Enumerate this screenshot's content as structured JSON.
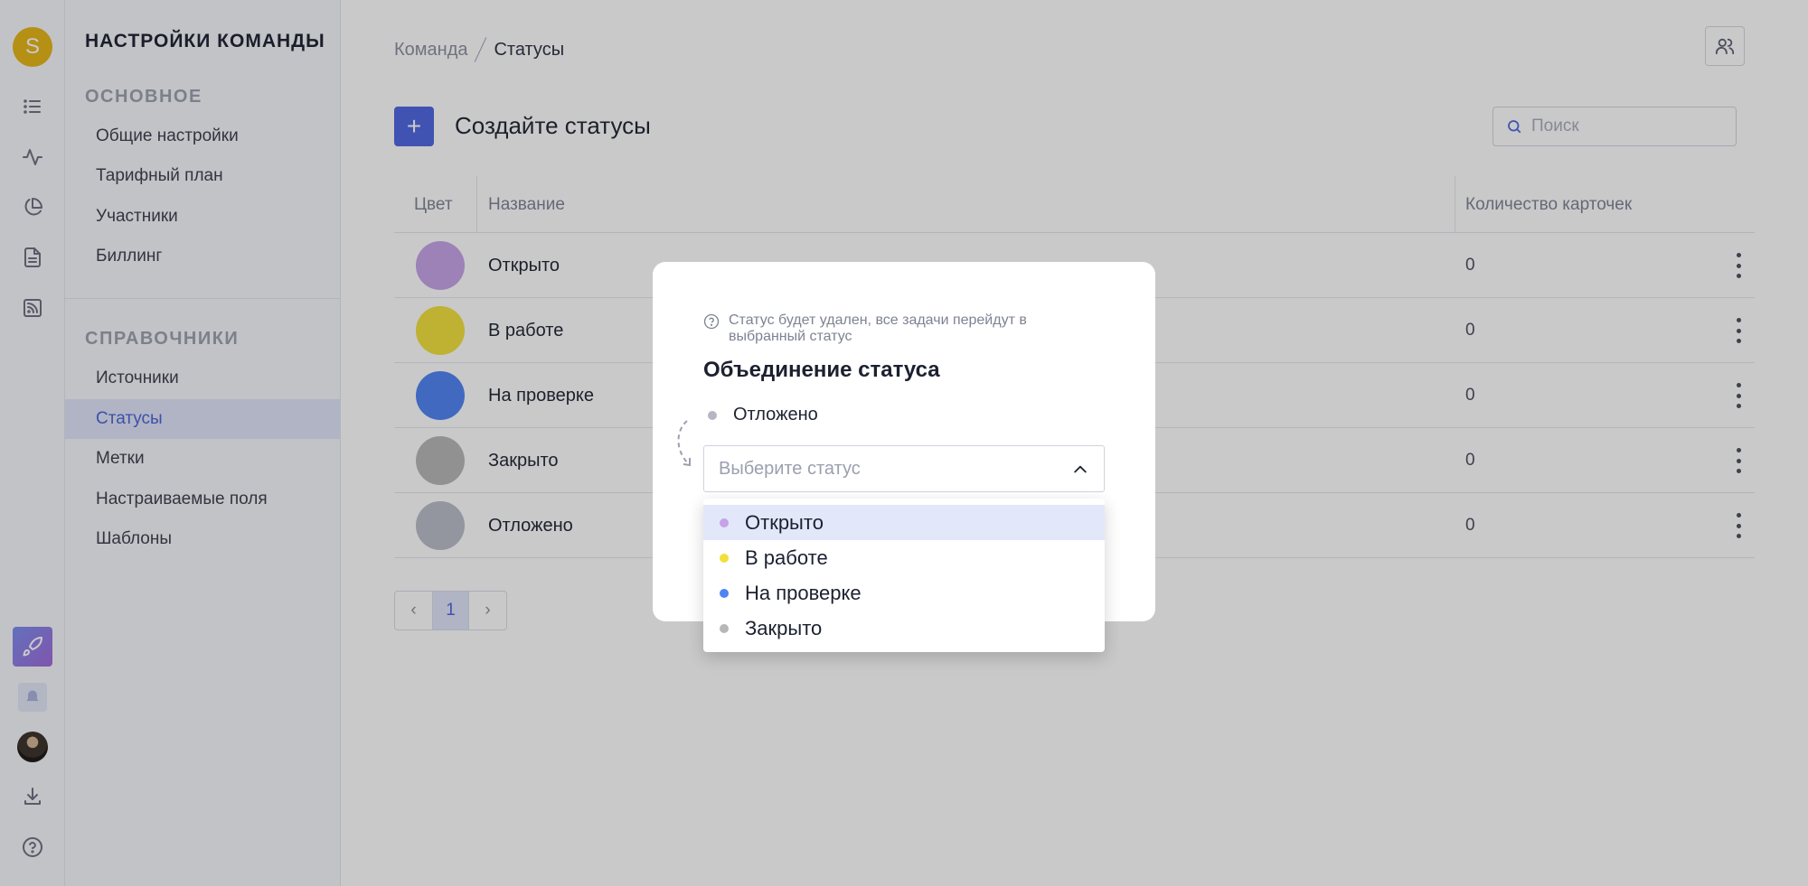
{
  "rail": {
    "user_initial": "S"
  },
  "settings": {
    "title": "НАСТРОЙКИ КОМАНДЫ",
    "section_main": "ОСНОВНОЕ",
    "main_items": [
      "Общие настройки",
      "Тарифный план",
      "Участники",
      "Биллинг"
    ],
    "section_refs": "СПРАВОЧНИКИ",
    "ref_items": [
      "Источники",
      "Статусы",
      "Метки",
      "Настраиваемые поля",
      "Шаблоны"
    ],
    "active_item": "Статусы"
  },
  "header": {
    "breadcrumb_root": "Команда",
    "breadcrumb_current": "Статусы"
  },
  "toolbar": {
    "add_label": "+",
    "title": "Создайте статусы",
    "search_placeholder": "Поиск"
  },
  "table": {
    "columns": [
      "Цвет",
      "Название",
      "Количество карточек"
    ],
    "rows": [
      {
        "name": "Открыто",
        "count": "0",
        "color": "#c5a3e6"
      },
      {
        "name": "В работе",
        "count": "0",
        "color": "#f2e03a"
      },
      {
        "name": "На проверке",
        "count": "0",
        "color": "#4f83f2"
      },
      {
        "name": "Закрыто",
        "count": "0",
        "color": "#b7b7b7"
      },
      {
        "name": "Отложено",
        "count": "0",
        "color": "#b9bcc8"
      }
    ]
  },
  "pagination": {
    "current_page": "1"
  },
  "modal": {
    "hint": "Статус будет удален, все задачи перейдут в выбранный статус",
    "title": "Объединение статуса",
    "source_status": "Отложено",
    "source_color": "#b4b7c2",
    "select_placeholder": "Выберите статус"
  },
  "dropdown": {
    "options": [
      {
        "label": "Открыто",
        "color": "#c5a3e6"
      },
      {
        "label": "В работе",
        "color": "#f2e03a"
      },
      {
        "label": "На проверке",
        "color": "#4f83f2"
      },
      {
        "label": "Закрыто",
        "color": "#b7b7b7"
      }
    ]
  }
}
